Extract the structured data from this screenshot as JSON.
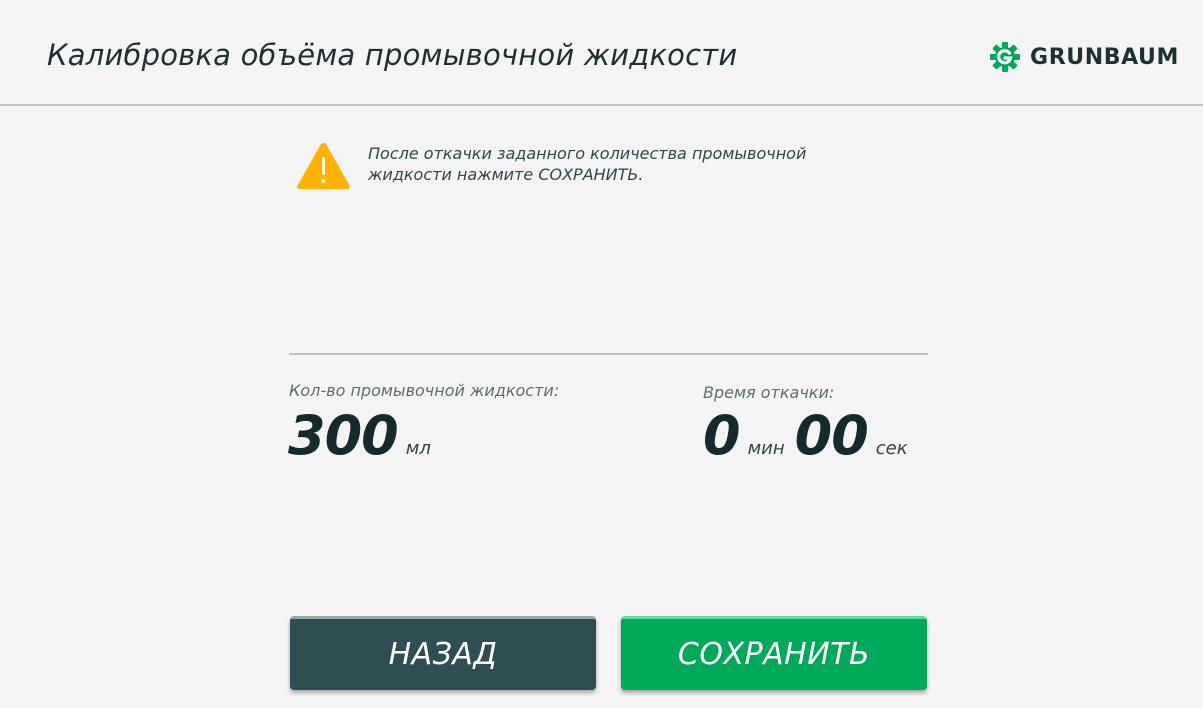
{
  "header": {
    "title": "Калибровка объёма промывочной жидкости",
    "brand": "GRUNBAUM"
  },
  "warning": {
    "icon": "warning-triangle-icon",
    "text": "После откачки заданного количества промывочной жидкости нажмите СОХРАНИТЬ."
  },
  "volume": {
    "label": "Кол-во промывочной жидкости:",
    "value": "300",
    "unit": "мл"
  },
  "time": {
    "label": "Время откачки:",
    "minutes": "0",
    "minutes_unit": "мин",
    "seconds": "00",
    "seconds_unit": "сек"
  },
  "buttons": {
    "back": "НАЗАД",
    "save": "СОХРАНИТЬ"
  },
  "colors": {
    "accent_green": "#00a859",
    "dark_teal": "#2f4e54",
    "warning_yellow": "#ffb300",
    "background": "#f4f4f4"
  }
}
